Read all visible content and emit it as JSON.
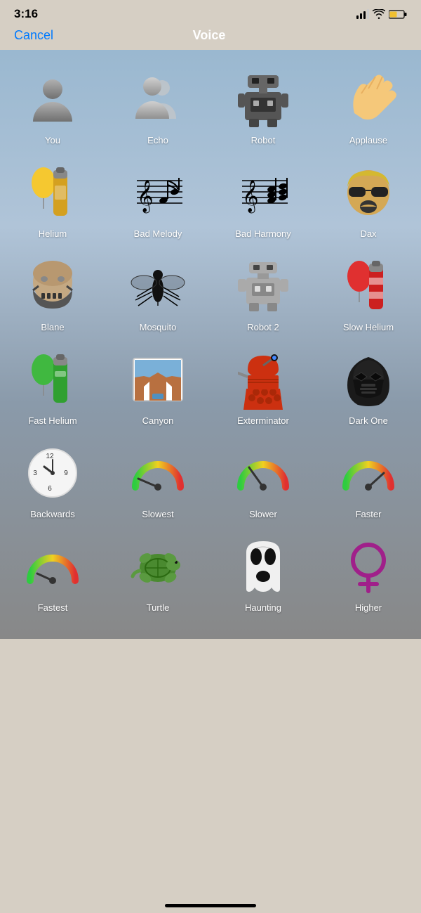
{
  "statusBar": {
    "time": "3:16"
  },
  "nav": {
    "cancelLabel": "Cancel",
    "title": "Voice"
  },
  "grid": [
    {
      "id": "you",
      "label": "You",
      "iconType": "person-gray"
    },
    {
      "id": "echo",
      "label": "Echo",
      "iconType": "person-echo"
    },
    {
      "id": "robot",
      "label": "Robot",
      "iconType": "robot"
    },
    {
      "id": "applause",
      "label": "Applause",
      "iconType": "hand"
    },
    {
      "id": "helium",
      "label": "Helium",
      "iconType": "helium-balloon"
    },
    {
      "id": "bad-melody",
      "label": "Bad Melody",
      "iconType": "music-notes1"
    },
    {
      "id": "bad-harmony",
      "label": "Bad Harmony",
      "iconType": "music-notes2"
    },
    {
      "id": "dax",
      "label": "Dax",
      "iconType": "dax-face"
    },
    {
      "id": "blane",
      "label": "Blane",
      "iconType": "bane-mask"
    },
    {
      "id": "mosquito",
      "label": "Mosquito",
      "iconType": "mosquito"
    },
    {
      "id": "robot2",
      "label": "Robot 2",
      "iconType": "robot2"
    },
    {
      "id": "slow-helium",
      "label": "Slow Helium",
      "iconType": "slow-helium"
    },
    {
      "id": "fast-helium",
      "label": "Fast Helium",
      "iconType": "fast-helium"
    },
    {
      "id": "canyon",
      "label": "Canyon",
      "iconType": "canyon"
    },
    {
      "id": "exterminator",
      "label": "Exterminator",
      "iconType": "exterminator"
    },
    {
      "id": "dark-one",
      "label": "Dark One",
      "iconType": "darth"
    },
    {
      "id": "backwards",
      "label": "Backwards",
      "iconType": "clock-backwards"
    },
    {
      "id": "slowest",
      "label": "Slowest",
      "iconType": "gauge-slowest"
    },
    {
      "id": "slower",
      "label": "Slower",
      "iconType": "gauge-slower"
    },
    {
      "id": "faster",
      "label": "Faster",
      "iconType": "gauge-faster"
    },
    {
      "id": "fastest",
      "label": "Fastest",
      "iconType": "gauge-fastest"
    },
    {
      "id": "turtle",
      "label": "Turtle",
      "iconType": "turtle"
    },
    {
      "id": "haunting",
      "label": "Haunting",
      "iconType": "ghost"
    },
    {
      "id": "higher",
      "label": "Higher",
      "iconType": "female-symbol"
    }
  ]
}
